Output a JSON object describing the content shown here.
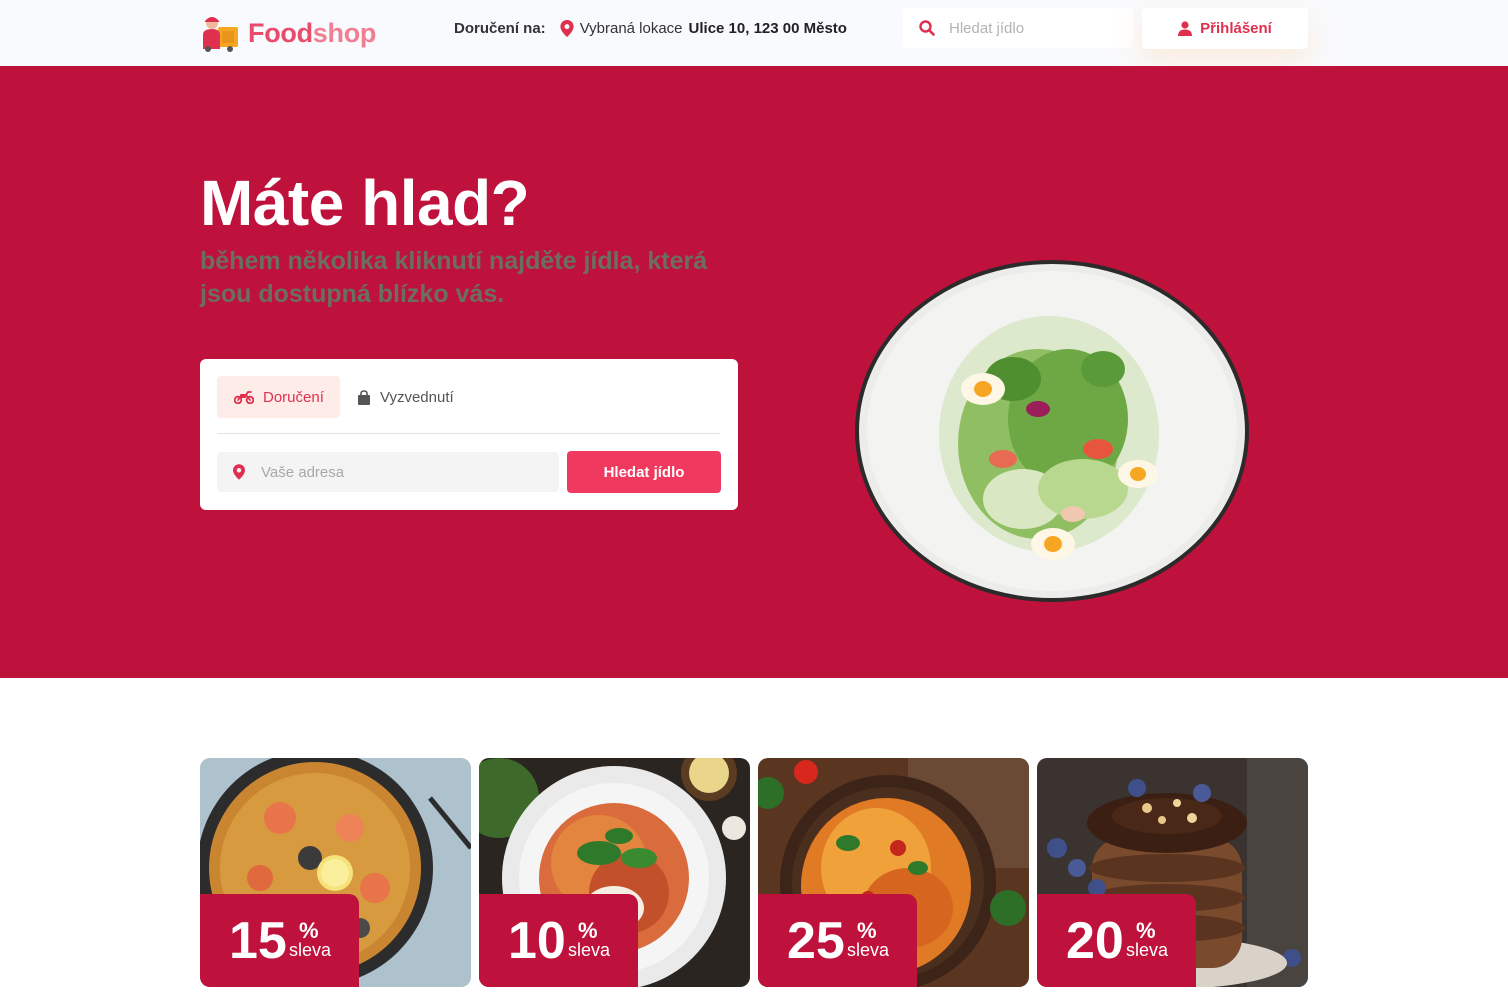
{
  "brand": {
    "name_part1": "Food",
    "name_part2": "shop"
  },
  "header": {
    "delivery_label": "Doručení na:",
    "location_prefix": "Vybraná lokace",
    "location_address": "Ulice 10, 123 00 Město",
    "search_placeholder": "Hledat jídlo",
    "login_label": "Přihlášení"
  },
  "hero": {
    "title": "Máte hlad?",
    "subtitle": "během několika kliknutí najděte jídla, která jsou dostupná blízko vás.",
    "tabs": [
      {
        "label": "Doručení",
        "icon": "motorcycle-icon",
        "active": true
      },
      {
        "label": "Vyzvednutí",
        "icon": "shopping-bag-icon",
        "active": false
      }
    ],
    "address_placeholder": "Vaše adresa",
    "search_button": "Hledat jídlo"
  },
  "deals": [
    {
      "dish": "paella",
      "discount": "15",
      "percent_sign": "%",
      "label": "sleva"
    },
    {
      "dish": "spaghetti",
      "discount": "10",
      "percent_sign": "%",
      "label": "sleva"
    },
    {
      "dish": "penne",
      "discount": "25",
      "percent_sign": "%",
      "label": "sleva"
    },
    {
      "dish": "chocolate-pancakes",
      "discount": "20",
      "percent_sign": "%",
      "label": "sleva"
    }
  ],
  "colors": {
    "brand": "#e94b6a",
    "hero_bg": "#be113c",
    "accent_button": "#f0395e",
    "tab_active_bg": "#fdece8",
    "subtitle": "#6b6f61"
  }
}
